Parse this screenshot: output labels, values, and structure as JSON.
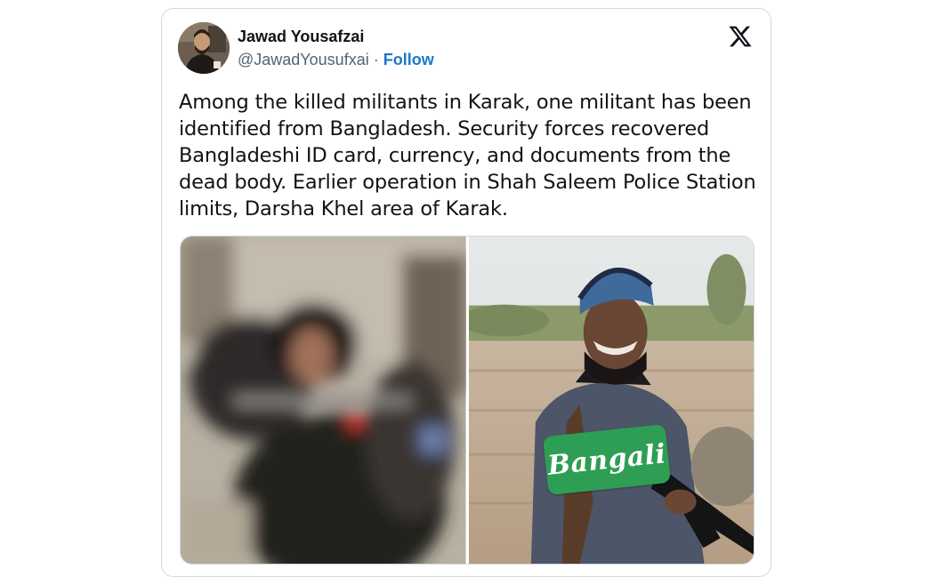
{
  "tweet": {
    "author": {
      "display_name": "Jawad Yousafzai",
      "handle": "@JawadYousufxai",
      "separator": " · ",
      "follow_label": "Follow",
      "avatar_icon": "user-avatar-photo"
    },
    "brand_icon": "x-logo-icon",
    "text": "Among the killed militants in Karak, one militant has been identified from Bangladesh. Security forces recovered Bangladeshi ID card, currency, and documents from the dead body. Earlier operation in Shah Saleem Police Station limits, Darsha Khel area of Karak.",
    "media": [
      {
        "kind": "blurred-photo",
        "caption": ""
      },
      {
        "kind": "photo",
        "overlay_text": "Bangali"
      }
    ]
  },
  "colors": {
    "text_primary": "#0f1419",
    "text_secondary": "#536471",
    "link": "#1d76c9",
    "border": "#cfd9de",
    "label_green": "#2f9e55"
  }
}
